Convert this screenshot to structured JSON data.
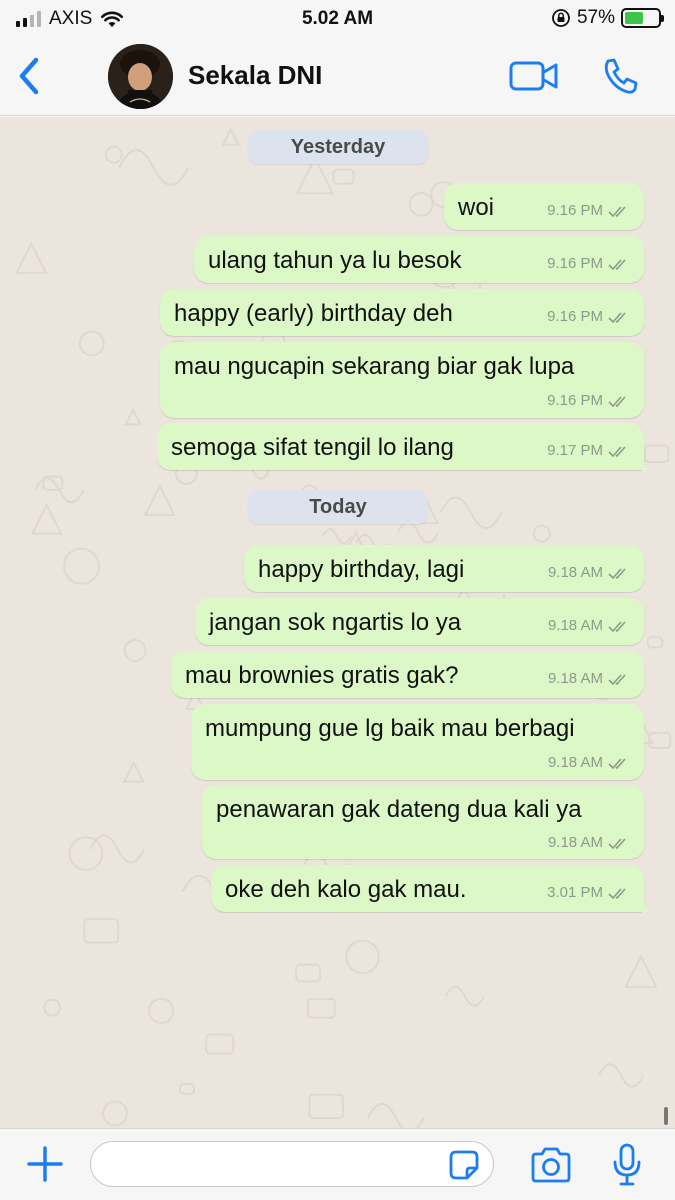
{
  "status_bar": {
    "carrier": "AXIS",
    "time": "5.02 AM",
    "battery_percent": "57%",
    "battery_level": 0.57,
    "signal_bars_active": 2,
    "icons": [
      "signal-icon",
      "wifi-icon",
      "orientation-lock-icon",
      "battery-charging-icon"
    ]
  },
  "header": {
    "contact_name": "Sekala DNI",
    "icons": [
      "back-chevron-icon",
      "avatar",
      "video-call-icon",
      "phone-call-icon"
    ],
    "accent_color": "#1a7ef2"
  },
  "chat": {
    "dates": [
      {
        "label": "Yesterday"
      },
      {
        "label": "Today"
      }
    ],
    "messages": [
      {
        "text": "woi",
        "time": "9.16 PM",
        "status": "read"
      },
      {
        "text": "ulang tahun ya lu besok",
        "time": "9.16 PM",
        "status": "read"
      },
      {
        "text": "happy (early) birthday deh",
        "time": "9.16 PM",
        "status": "read"
      },
      {
        "text": "mau ngucapin sekarang biar gak lupa",
        "time": "9.16 PM",
        "status": "read"
      },
      {
        "text": "semoga sifat tengil lo ilang",
        "time": "9.17 PM",
        "status": "read"
      },
      {
        "text": "happy birthday, lagi",
        "time": "9.18 AM",
        "status": "read"
      },
      {
        "text": "jangan sok ngartis lo ya",
        "time": "9.18 AM",
        "status": "read"
      },
      {
        "text": "mau brownies gratis gak?",
        "time": "9.18 AM",
        "status": "read"
      },
      {
        "text": "mumpung gue lg baik mau berbagi",
        "time": "9.18 AM",
        "status": "read"
      },
      {
        "text": "penawaran gak dateng dua kali ya",
        "time": "9.18 AM",
        "status": "read"
      },
      {
        "text": "oke deh kalo gak mau.",
        "time": "3.01 PM",
        "status": "read"
      }
    ],
    "outgoing_bubble_color": "#dcf8c6",
    "background_color": "#ece5dd"
  },
  "input_bar": {
    "value": "",
    "placeholder": "",
    "icons": [
      "plus-icon",
      "sticker-icon",
      "camera-icon",
      "microphone-icon"
    ]
  }
}
